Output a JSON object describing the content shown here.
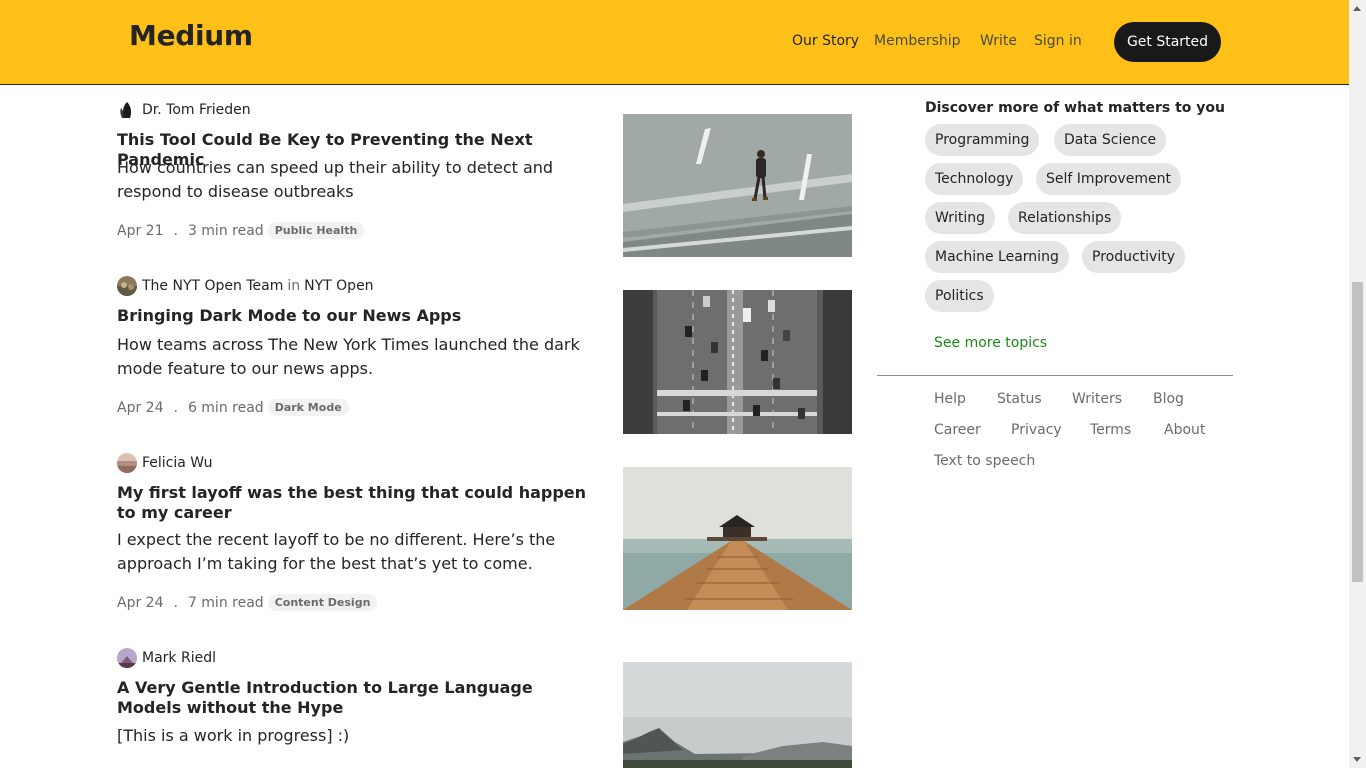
{
  "header": {
    "logo": "Medium",
    "nav": [
      "Our Story",
      "Membership",
      "Write",
      "Sign in"
    ],
    "cta": "Get Started",
    "background": "#ffc017"
  },
  "articles": [
    {
      "author": "Dr. Tom Frieden",
      "publication": "",
      "title": "This Tool Could Be Key to Preventing the Next Pandemic",
      "subtitle": "How countries can speed up their ability to detect and respond to disease outbreaks",
      "date": "Apr 21",
      "dot": ".",
      "read_time": "3 min read",
      "tag": "Public Health"
    },
    {
      "author": "The NYT Open Team",
      "in_word": "in",
      "publication": "NYT Open",
      "title": "Bringing Dark Mode to our News Apps",
      "subtitle": "How teams across The New York Times launched the dark mode feature to our news apps.",
      "date": "Apr 24",
      "dot": ".",
      "read_time": "6 min read",
      "tag": "Dark Mode"
    },
    {
      "author": "Felicia Wu",
      "publication": "",
      "title": "My first layoff was the best thing that could happen to my career",
      "subtitle": "I expect the recent layoff to be no different. Here’s the approach I’m taking for the best that’s yet to come.",
      "date": "Apr 24",
      "dot": ".",
      "read_time": "7 min read",
      "tag": "Content Design"
    },
    {
      "author": "Mark Riedl",
      "publication": "",
      "title": "A Very Gentle Introduction to Large Language Models without the Hype",
      "subtitle": "[This is a work in progress] :)"
    }
  ],
  "sidebar": {
    "title": "Discover more of what matters to you",
    "topics": [
      "Programming",
      "Data Science",
      "Technology",
      "Self Improvement",
      "Writing",
      "Relationships",
      "Machine Learning",
      "Productivity",
      "Politics"
    ],
    "see_more": "See more topics",
    "footer_links": [
      "Help",
      "Status",
      "Writers",
      "Blog",
      "Career",
      "Privacy",
      "Terms",
      "About",
      "Text to speech"
    ]
  }
}
